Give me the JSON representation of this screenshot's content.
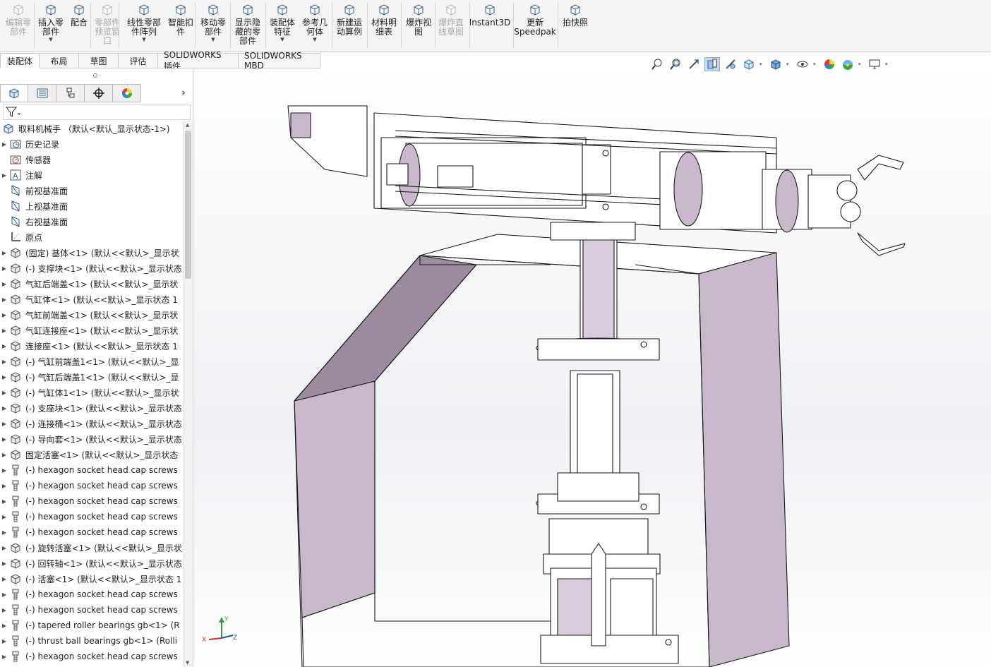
{
  "ribbon": {
    "buttons": [
      {
        "label": "编辑零\n部件",
        "disabled": true,
        "dropdown": false
      },
      {
        "label": "插入零\n部件",
        "disabled": false,
        "dropdown": true
      },
      {
        "label": "配合",
        "disabled": false,
        "dropdown": false
      },
      {
        "label": "零部件\n预览窗\n口",
        "disabled": true,
        "dropdown": false
      },
      {
        "label": "线性零部\n件阵列",
        "disabled": false,
        "dropdown": true
      },
      {
        "label": "智能扣\n件",
        "disabled": false,
        "dropdown": false
      },
      {
        "label": "移动零\n部件",
        "disabled": false,
        "dropdown": true
      },
      {
        "label": "显示隐\n藏的零\n部件",
        "disabled": false,
        "dropdown": false
      },
      {
        "label": "装配体\n特征",
        "disabled": false,
        "dropdown": true
      },
      {
        "label": "参考几\n何体",
        "disabled": false,
        "dropdown": true
      },
      {
        "label": "新建运\n动算例",
        "disabled": false,
        "dropdown": false
      },
      {
        "label": "材料明\n细表",
        "disabled": false,
        "dropdown": false
      },
      {
        "label": "爆炸视\n图",
        "disabled": false,
        "dropdown": false
      },
      {
        "label": "爆炸直\n线草图",
        "disabled": true,
        "dropdown": false
      },
      {
        "label": "Instant3D",
        "disabled": false,
        "dropdown": false
      },
      {
        "label": "更新\nSpeedpak",
        "disabled": false,
        "dropdown": false
      },
      {
        "label": "拍快照",
        "disabled": false,
        "dropdown": false
      }
    ]
  },
  "tabs": [
    "装配体",
    "布局",
    "草图",
    "评估",
    "SOLIDWORKS 插件",
    "SOLIDWORKS MBD"
  ],
  "tree": {
    "root": "取料机械手 （默认<默认_显示状态-1>)",
    "items": [
      {
        "label": "历史记录",
        "icon": "history-folder-icon",
        "expand": true
      },
      {
        "label": "传感器",
        "icon": "sensor-icon",
        "expand": false
      },
      {
        "label": "注解",
        "icon": "annotation-icon",
        "expand": true
      },
      {
        "label": "前视基准面",
        "icon": "plane-icon",
        "expand": false
      },
      {
        "label": "上视基准面",
        "icon": "plane-icon",
        "expand": false
      },
      {
        "label": "右视基准面",
        "icon": "plane-icon",
        "expand": false
      },
      {
        "label": "原点",
        "icon": "origin-icon",
        "expand": false
      },
      {
        "label": "(固定) 基体<1> (默认<<默认>_显示状",
        "icon": "part-icon",
        "expand": true
      },
      {
        "label": "(-) 支撑块<1> (默认<<默认>_显示状态",
        "icon": "part-icon",
        "expand": true
      },
      {
        "label": "气缸后端盖<1> (默认<<默认>_显示状",
        "icon": "part-icon",
        "expand": true
      },
      {
        "label": "气缸体<1> (默认<<默认>_显示状态 1",
        "icon": "part-icon",
        "expand": true
      },
      {
        "label": "气缸前端盖<1> (默认<<默认>_显示状",
        "icon": "part-icon",
        "expand": true
      },
      {
        "label": "气缸连接座<1> (默认<<默认>_显示状",
        "icon": "part-icon",
        "expand": true
      },
      {
        "label": "连接座<1> (默认<<默认>_显示状态 1",
        "icon": "part-icon",
        "expand": true
      },
      {
        "label": "(-) 气缸前端盖1<1> (默认<<默认>_显",
        "icon": "part-icon",
        "expand": true
      },
      {
        "label": "(-) 气缸后端盖1<1> (默认<<默认>_显",
        "icon": "part-icon",
        "expand": true
      },
      {
        "label": "(-) 气缸体1<1> (默认<<默认>_显示状",
        "icon": "part-icon",
        "expand": true
      },
      {
        "label": "(-) 支座块<1> (默认<<默认>_显示状态",
        "icon": "part-icon",
        "expand": true
      },
      {
        "label": "(-) 连接桶<1> (默认<<默认>_显示状态",
        "icon": "part-icon",
        "expand": true
      },
      {
        "label": "(-) 导向套<1> (默认<<默认>_显示状态",
        "icon": "part-icon",
        "expand": true
      },
      {
        "label": "固定活塞<1> (默认<<默认>_显示状态",
        "icon": "part-icon",
        "expand": true
      },
      {
        "label": "(-) hexagon socket head cap screws",
        "icon": "screw-icon",
        "expand": true
      },
      {
        "label": "(-) hexagon socket head cap screws",
        "icon": "screw-icon",
        "expand": true
      },
      {
        "label": "(-) hexagon socket head cap screws",
        "icon": "screw-icon",
        "expand": true
      },
      {
        "label": "(-) hexagon socket head cap screws",
        "icon": "screw-icon",
        "expand": true
      },
      {
        "label": "(-) hexagon socket head cap screws",
        "icon": "screw-icon",
        "expand": true
      },
      {
        "label": "(-) 旋转活塞<1> (默认<<默认>_显示状",
        "icon": "part-icon",
        "expand": true
      },
      {
        "label": "(-) 回转轴<1> (默认<<默认>_显示状态",
        "icon": "part-icon",
        "expand": true
      },
      {
        "label": "(-) 活塞<1> (默认<<默认>_显示状态 1",
        "icon": "part-icon",
        "expand": true
      },
      {
        "label": "(-) hexagon socket head cap screws",
        "icon": "screw-icon",
        "expand": true
      },
      {
        "label": "(-) hexagon socket head cap screws",
        "icon": "screw-icon",
        "expand": true
      },
      {
        "label": "(-) tapered roller bearings gb<1> (R",
        "icon": "screw-icon",
        "expand": true
      },
      {
        "label": "(-) thrust ball bearings gb<1> (Rolli",
        "icon": "screw-icon",
        "expand": true
      },
      {
        "label": "(-) hexagon socket head cap screws",
        "icon": "screw-icon",
        "expand": true
      }
    ]
  },
  "colors": {
    "accent": "#1f6fb8",
    "part_face": "#c9b8cc",
    "part_dark": "#9c8a9e"
  }
}
